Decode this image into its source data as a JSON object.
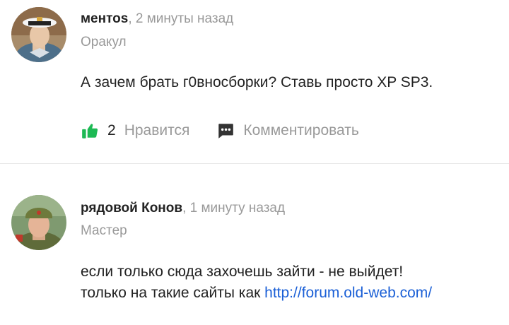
{
  "answers": [
    {
      "author": "ментоs",
      "separator": ",",
      "time": "2 минуты назад",
      "rank": "Оракул",
      "text": "А зачем брать г0вносборки? Ставь просто XP SP3.",
      "likes": {
        "count": "2",
        "label": "Нравится",
        "icon": "thumbs-up-icon",
        "color": "#1db954"
      },
      "comment": {
        "label": "Комментировать",
        "icon": "comment-icon",
        "color": "#333333"
      }
    },
    {
      "author": "рядовой Конов",
      "separator": ",",
      "time": "1 минуту назад",
      "rank": "Мастер",
      "text_line1": "если только сюда захочешь зайти - не выйдет!",
      "text_line2": "только на такие сайты как ",
      "link": "http://forum.old-web.com/"
    }
  ],
  "colors": {
    "text": "#222222",
    "muted": "#999999",
    "link": "#1a5fd6",
    "divider": "#e8e8e8"
  }
}
